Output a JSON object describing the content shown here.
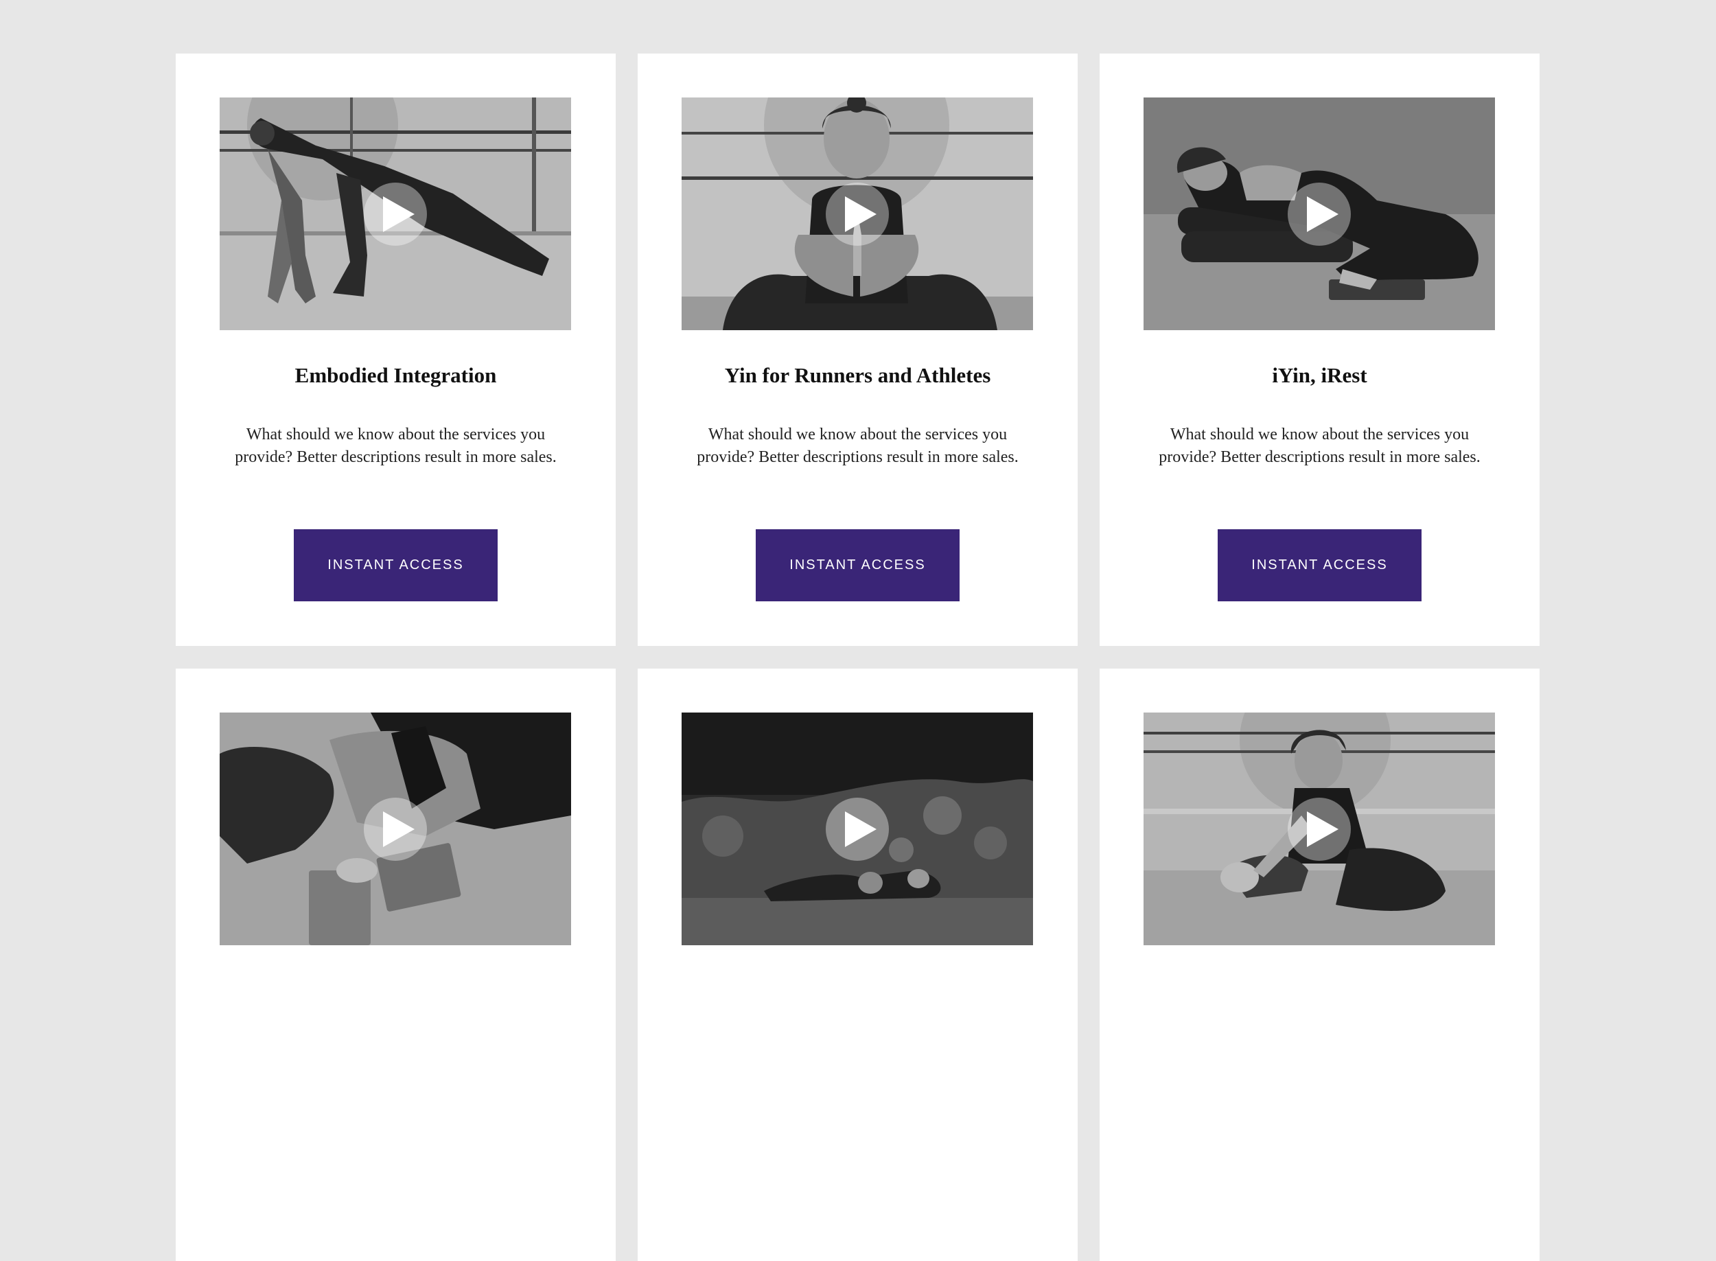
{
  "cards": [
    {
      "title": "Embodied Integration",
      "description": "What should we know about the services you provide? Better descriptions result in more sales.",
      "button_label": "INSTANT ACCESS",
      "image": "woman-lunge-stretch-studio"
    },
    {
      "title": "Yin for Runners and Athletes",
      "description": "What should we know about the services you provide? Better descriptions result in more sales.",
      "button_label": "INSTANT ACCESS",
      "image": "woman-laughing-prayer-hands"
    },
    {
      "title": "iYin, iRest",
      "description": "What should we know about the services you provide? Better descriptions result in more sales.",
      "button_label": "INSTANT ACCESS",
      "image": "woman-reclined-on-bolster"
    },
    {
      "title": "",
      "description": "",
      "button_label": "",
      "image": "woman-forward-fold-on-blocks"
    },
    {
      "title": "",
      "description": "",
      "button_label": "",
      "image": "person-lying-outdoors-garden"
    },
    {
      "title": "",
      "description": "",
      "button_label": "",
      "image": "woman-seated-forward-bend"
    }
  ],
  "icons": {
    "play": "play-icon"
  },
  "colors": {
    "page_background": "#e7e7e7",
    "card_background": "#ffffff",
    "button_background": "#3a2577",
    "button_text": "#ffffff"
  }
}
